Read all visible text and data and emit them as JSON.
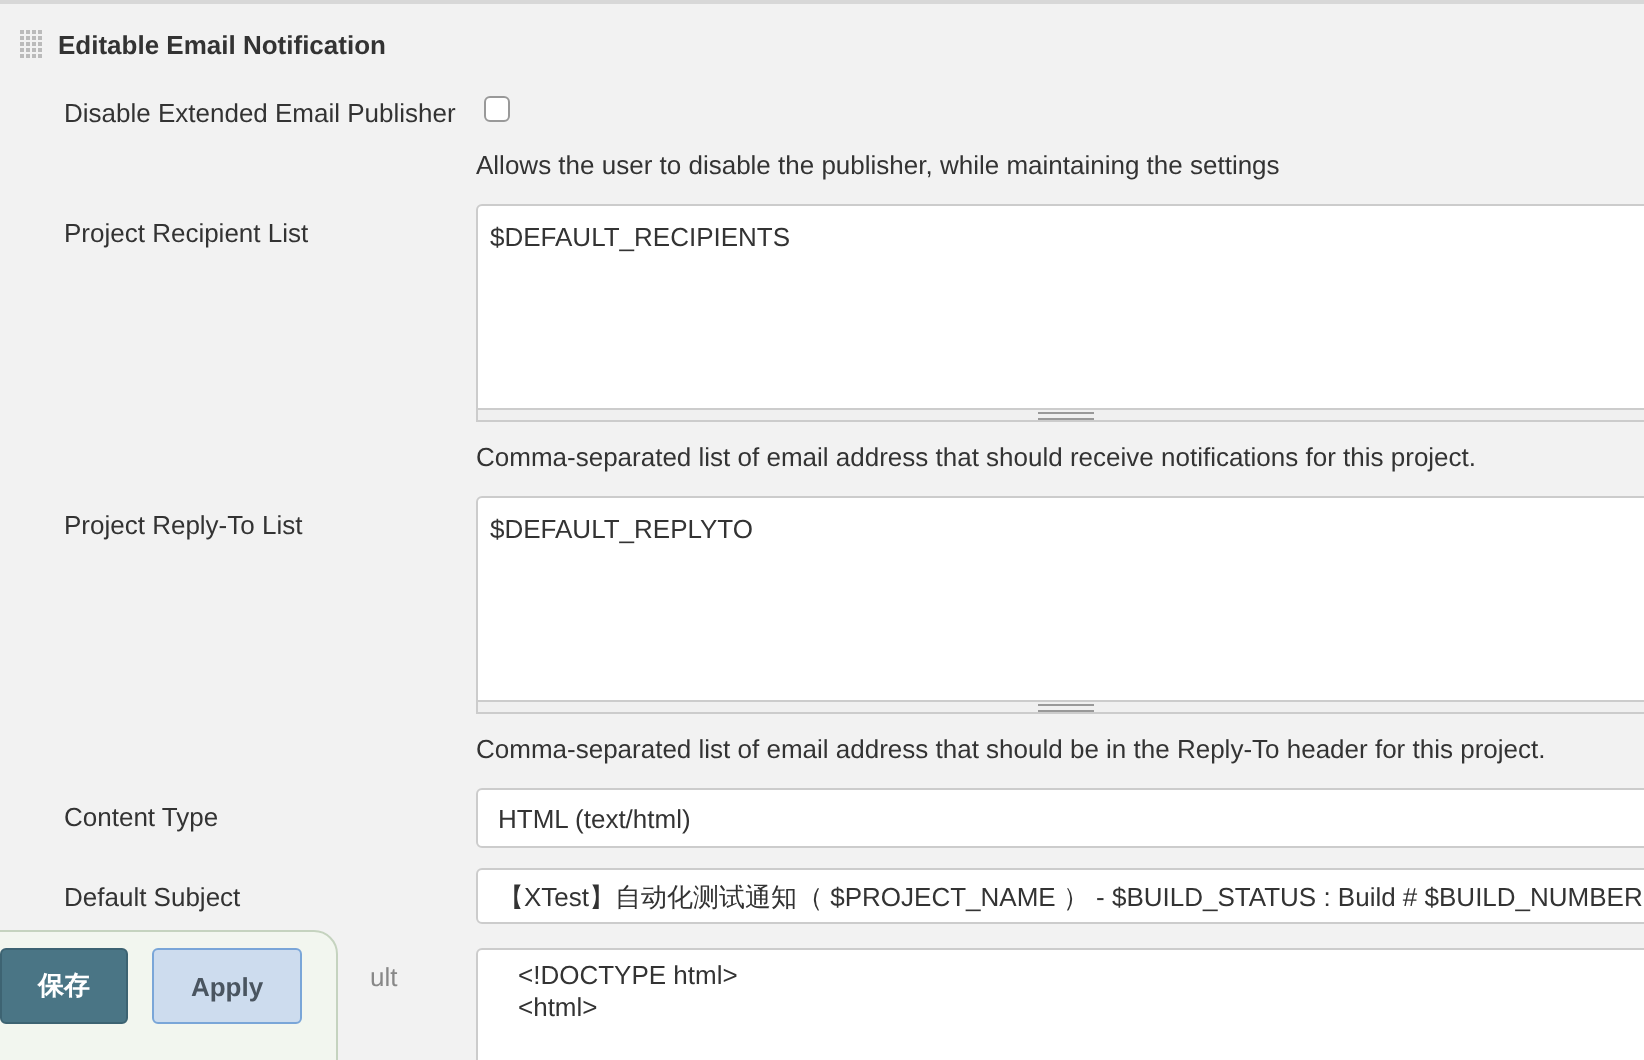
{
  "section": {
    "title": "Editable Email Notification"
  },
  "rows": [
    {
      "kind": "checkbox",
      "label": "Disable Extended Email Publisher",
      "checked": false,
      "help": "Allows the user to disable the publisher, while maintaining the settings"
    },
    {
      "kind": "textarea",
      "label": "Project Recipient List",
      "value": "$DEFAULT_RECIPIENTS",
      "help": "Comma-separated list of email address that should receive notifications for this project."
    },
    {
      "kind": "textarea",
      "label": "Project Reply-To List",
      "value": "$DEFAULT_REPLYTO",
      "help": "Comma-separated list of email address that should be in the Reply-To header for this project."
    },
    {
      "kind": "select",
      "label": "Content Type",
      "value": "HTML (text/html)"
    },
    {
      "kind": "text",
      "label": "Default Subject",
      "value": "【XTest】自动化测试通知（ $PROJECT_NAME ）  - $BUILD_STATUS : Build # $BUILD_NUMBER"
    },
    {
      "kind": "code",
      "label": "ult",
      "lines": [
        "<!DOCTYPE html>",
        "<html>"
      ]
    }
  ],
  "footer_buttons": [
    {
      "kind": "primary",
      "label": "保存"
    },
    {
      "kind": "secondary",
      "label": "Apply"
    }
  ]
}
